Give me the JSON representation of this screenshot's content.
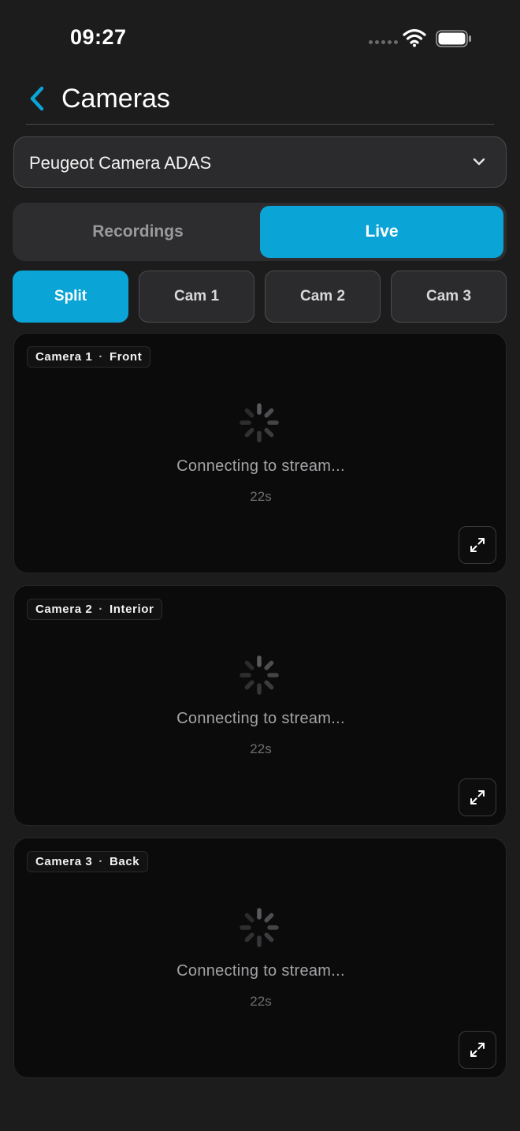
{
  "status_bar": {
    "time": "09:27",
    "signal_icon": "cellular-dots-icon",
    "wifi_icon": "wifi-icon",
    "battery_icon": "battery-icon"
  },
  "header": {
    "title": "Cameras",
    "back_icon": "chevron-left-icon"
  },
  "device_select": {
    "value": "Peugeot Camera ADAS",
    "icon": "chevron-down-icon"
  },
  "mode_tabs": [
    {
      "label": "Recordings",
      "selected": false
    },
    {
      "label": "Live",
      "selected": true
    }
  ],
  "view_chips": [
    {
      "label": "Split",
      "selected": true
    },
    {
      "label": "Cam 1",
      "selected": false
    },
    {
      "label": "Cam 2",
      "selected": false
    },
    {
      "label": "Cam 3",
      "selected": false
    }
  ],
  "cameras": [
    {
      "name": "Camera 1",
      "separator": "·",
      "position": "Front",
      "status": "Connecting to stream...",
      "elapsed": "22s"
    },
    {
      "name": "Camera 2",
      "separator": "·",
      "position": "Interior",
      "status": "Connecting to stream...",
      "elapsed": "22s"
    },
    {
      "name": "Camera 3",
      "separator": "·",
      "position": "Back",
      "status": "Connecting to stream...",
      "elapsed": "22s"
    }
  ],
  "colors": {
    "accent": "#0aa4d6",
    "background": "#1c1c1d",
    "card": "#0b0b0c"
  }
}
